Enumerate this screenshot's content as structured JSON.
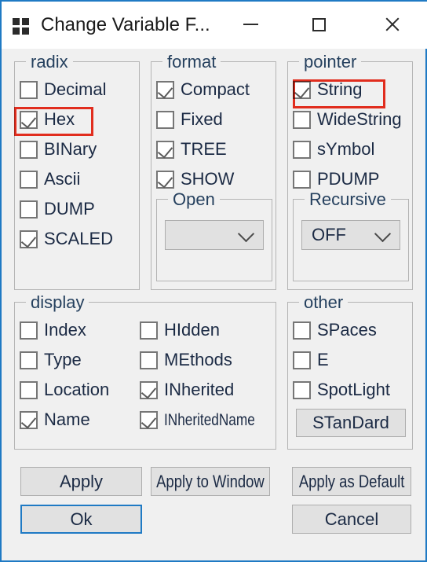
{
  "window": {
    "title": "Change Variable F...",
    "icon": "grid-2x2-icon",
    "accent_color": "#1f7ac4",
    "background_color": "#f0f0f0",
    "highlight_color": "#f03020",
    "controls": {
      "minimize": "minimize-icon",
      "maximize": "maximize-icon",
      "close": "close-icon"
    }
  },
  "groups": {
    "radix": {
      "legend": "radix",
      "items": [
        {
          "label": "Decimal",
          "checked": false
        },
        {
          "label": "Hex",
          "checked": true,
          "highlighted": true
        },
        {
          "label": "BINary",
          "checked": false
        },
        {
          "label": "Ascii",
          "checked": false
        },
        {
          "label": "DUMP",
          "checked": false
        },
        {
          "label": "SCALED",
          "checked": true
        }
      ]
    },
    "format": {
      "legend": "format",
      "items": [
        {
          "label": "Compact",
          "checked": true
        },
        {
          "label": "Fixed",
          "checked": false
        },
        {
          "label": "TREE",
          "checked": true
        },
        {
          "label": "SHOW",
          "checked": true
        }
      ],
      "open": {
        "legend": "Open",
        "value": "",
        "placeholder": ""
      }
    },
    "pointer": {
      "legend": "pointer",
      "items": [
        {
          "label": "String",
          "checked": true,
          "highlighted": true
        },
        {
          "label": "WideString",
          "checked": false
        },
        {
          "label": "sYmbol",
          "checked": false
        },
        {
          "label": "PDUMP",
          "checked": false
        }
      ],
      "recursive": {
        "legend": "Recursive",
        "value": "OFF"
      }
    },
    "display": {
      "legend": "display",
      "column1": [
        {
          "label": "Index",
          "checked": false
        },
        {
          "label": "Type",
          "checked": false
        },
        {
          "label": "Location",
          "checked": false
        },
        {
          "label": "Name",
          "checked": true
        }
      ],
      "column2": [
        {
          "label": "HIdden",
          "checked": false
        },
        {
          "label": "MEthods",
          "checked": false
        },
        {
          "label": "INherited",
          "checked": true
        },
        {
          "label": "INheritedName",
          "checked": true
        }
      ]
    },
    "other": {
      "legend": "other",
      "items": [
        {
          "label": "SPaces",
          "checked": false
        },
        {
          "label": "E",
          "checked": false
        },
        {
          "label": "SpotLight",
          "checked": false
        }
      ],
      "standard_button": "STanDard"
    }
  },
  "footer": {
    "apply": "Apply",
    "apply_to_window": "Apply to Window",
    "apply_as_default": "Apply as Default",
    "ok": "Ok",
    "cancel": "Cancel"
  }
}
